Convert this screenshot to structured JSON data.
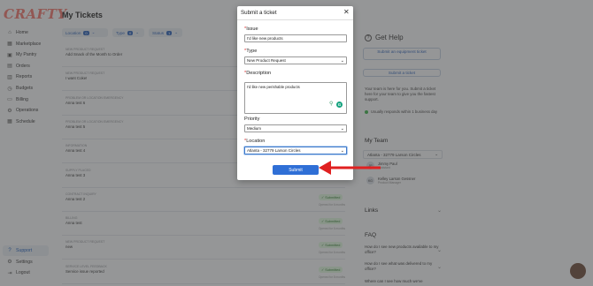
{
  "app": {
    "logo": "CRAFTY",
    "page_title": "My Tickets"
  },
  "sidebar": {
    "items": [
      {
        "label": "Home",
        "icon": "home-icon",
        "glyph": "⌂"
      },
      {
        "label": "Marketplace",
        "icon": "store-icon",
        "glyph": "▦"
      },
      {
        "label": "My Pantry",
        "icon": "pantry-icon",
        "glyph": "▣"
      },
      {
        "label": "Orders",
        "icon": "orders-icon",
        "glyph": "▤"
      },
      {
        "label": "Reports",
        "icon": "reports-icon",
        "glyph": "▥"
      },
      {
        "label": "Budgets",
        "icon": "budget-icon",
        "glyph": "◷"
      },
      {
        "label": "Billing",
        "icon": "billing-icon",
        "glyph": "▭"
      },
      {
        "label": "Operations",
        "icon": "operations-icon",
        "glyph": "⚙"
      },
      {
        "label": "Schedule",
        "icon": "schedule-icon",
        "glyph": "▦"
      }
    ],
    "bottom": [
      {
        "label": "Support",
        "icon": "support-icon",
        "glyph": "?",
        "active": true
      },
      {
        "label": "Settings",
        "icon": "settings-icon",
        "glyph": "⚙"
      },
      {
        "label": "Logout",
        "icon": "logout-icon",
        "glyph": "⇥"
      }
    ]
  },
  "filters": {
    "location": {
      "label": "Location",
      "count": "0"
    },
    "type": {
      "label": "Type",
      "count": "0"
    },
    "status": {
      "label": "Status",
      "count": "1"
    }
  },
  "tickets": [
    {
      "type": "NEW PRODUCT REQUEST",
      "name": "Add Snack of the Month to Order",
      "badge": "",
      "opened": ""
    },
    {
      "type": "NEW PRODUCT REQUEST",
      "name": "I want Coke!",
      "badge": "",
      "opened": ""
    },
    {
      "type": "PROBLEM OR LOCATION EMERGENCY",
      "name": "Anna test 6",
      "badge": "",
      "opened": ""
    },
    {
      "type": "PROBLEM OR LOCATION EMERGENCY",
      "name": "Anna test 5",
      "badge": "",
      "opened": ""
    },
    {
      "type": "INFORMATION",
      "name": "Anna test 4",
      "badge": "",
      "opened": ""
    },
    {
      "type": "SUPPLY PLACED",
      "name": "Anna test 3",
      "badge": "",
      "opened": ""
    },
    {
      "type": "CONTRACT INQUIRY",
      "name": "Anna test 2",
      "badge": "Submitted",
      "opened": "Opened for 6 months"
    },
    {
      "type": "BILLING",
      "name": "Anna test",
      "badge": "Submitted",
      "opened": "Opened for 6 months"
    },
    {
      "type": "NEW PRODUCT REQUEST",
      "name": "new",
      "badge": "Submitted",
      "opened": "Opened for 6 months"
    },
    {
      "type": "SERVICE LEVEL FEEDBACK",
      "name": "Service issue reported",
      "badge": "Submitted",
      "opened": "Opened for 8 months"
    }
  ],
  "help": {
    "title": "Get Help",
    "btn_equipment": "Submit an equipment ticket",
    "btn_ticket": "Submit a ticket",
    "text": "Your team is here for you. Submit a ticket here for your team to give you the fastest support.",
    "response": "Usually responds within 1 business day",
    "my_team": "My Team",
    "team_location": "Atlanta - 32779 Larson Circles",
    "members": [
      {
        "initials": "JP",
        "name": "Jimmy Paul",
        "role": "Assistant"
      },
      {
        "initials": "KG",
        "name": "Kelley Larson Gessner",
        "role": "Product Manager"
      }
    ],
    "links": "Links",
    "faq": "FAQ",
    "faq_items": [
      "How do I see new products available to my office?",
      "How do I see what was delivered to my office?",
      "Where can I see how much we've"
    ]
  },
  "modal": {
    "title": "Submit a ticket",
    "close_glyph": "✕",
    "issue_label": "Issue",
    "issue_value": "I'd like new products",
    "type_label": "Type",
    "type_value": "New Product Request",
    "description_label": "Description",
    "description_value": "I'd like new perishable products",
    "priority_label": "Priority",
    "priority_value": "Medium",
    "location_label": "Location",
    "location_value": "Atlanta - 32779 Larson Circles",
    "submit_label": "Submit"
  },
  "colors": {
    "accent": "#2f6fd6",
    "annotation_arrow": "#e02020",
    "logo": "#e8736b"
  }
}
